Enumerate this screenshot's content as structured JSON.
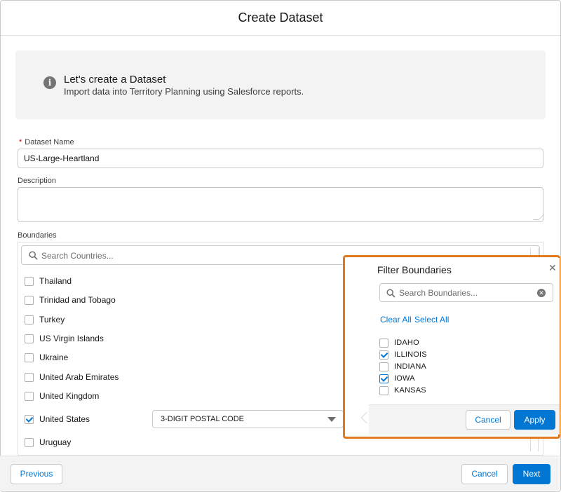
{
  "modal": {
    "title": "Create Dataset"
  },
  "info": {
    "icon": "info-icon",
    "title": "Let's create a Dataset",
    "subtitle": "Import data into Territory Planning using Salesforce reports."
  },
  "form": {
    "required_mark": "*",
    "dataset_name_label": "Dataset Name",
    "dataset_name_value": "US-Large-Heartland",
    "description_label": "Description",
    "description_value": "",
    "boundaries_label": "Boundaries"
  },
  "countries": {
    "search_placeholder": "Search Countries...",
    "items": [
      {
        "label": "Thailand",
        "checked": false
      },
      {
        "label": "Trinidad and Tobago",
        "checked": false
      },
      {
        "label": "Turkey",
        "checked": false
      },
      {
        "label": "US Virgin Islands",
        "checked": false
      },
      {
        "label": "Ukraine",
        "checked": false
      },
      {
        "label": "United Arab Emirates",
        "checked": false
      },
      {
        "label": "United Kingdom",
        "checked": false
      },
      {
        "label": "United States",
        "checked": true
      },
      {
        "label": "Uruguay",
        "checked": false
      }
    ],
    "boundary_level_value": "3-DIGIT POSTAL CODE"
  },
  "popover": {
    "title": "Filter Boundaries",
    "close_icon": "close-icon",
    "search_placeholder": "Search Boundaries...",
    "clear_all": "Clear All",
    "select_all": "Select All",
    "items": [
      {
        "label": "IDAHO",
        "checked": false
      },
      {
        "label": "ILLINOIS",
        "checked": true
      },
      {
        "label": "INDIANA",
        "checked": false
      },
      {
        "label": "IOWA",
        "checked": true
      },
      {
        "label": "KANSAS",
        "checked": false
      }
    ],
    "cancel": "Cancel",
    "apply": "Apply"
  },
  "footer": {
    "previous": "Previous",
    "cancel": "Cancel",
    "next": "Next"
  },
  "colors": {
    "brand": "#0176d3",
    "highlight": "#e07a1f",
    "required": "#ba0517"
  }
}
